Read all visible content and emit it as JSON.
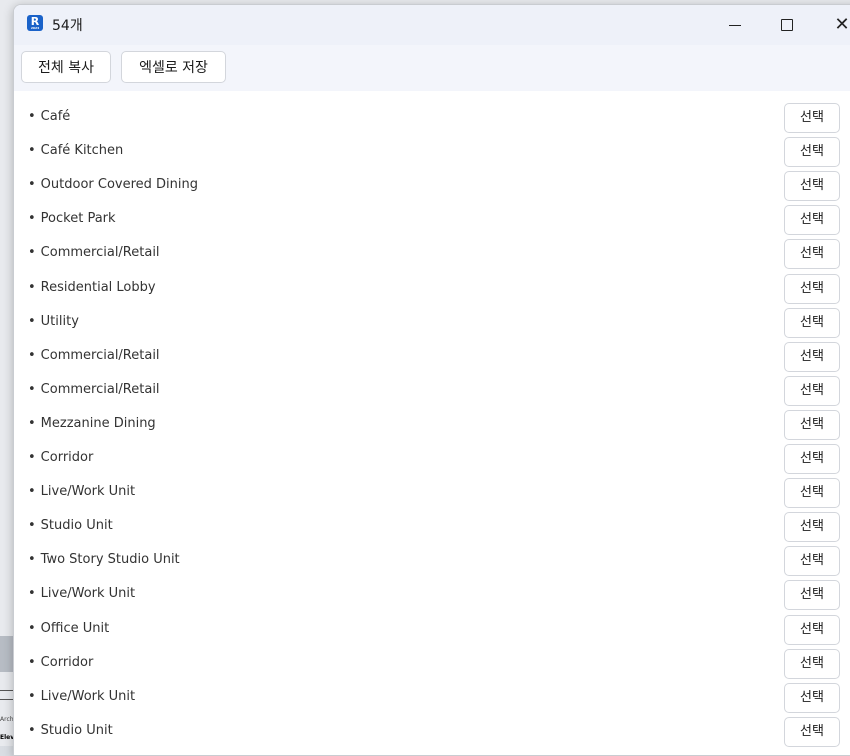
{
  "window": {
    "title": "54개",
    "app_icon_letter": "R",
    "app_icon_sub": "2024",
    "controls": {
      "minimize_icon": "minimize-icon",
      "maximize_icon": "maximize-icon",
      "close_icon": "close-icon",
      "close_glyph": "✕"
    }
  },
  "toolbar": {
    "copy_all_label": "전체 복사",
    "save_excel_label": "엑셀로 저장"
  },
  "list": {
    "bullet": "•",
    "select_label": "선택",
    "items": [
      "Café",
      "Café Kitchen",
      "Outdoor Covered Dining",
      "Pocket Park",
      "Commercial/Retail",
      "Residential Lobby",
      "Utility",
      "Commercial/Retail",
      "Commercial/Retail",
      "Mezzanine Dining",
      "Corridor",
      "Live/Work Unit",
      "Studio Unit",
      "Two Story Studio Unit",
      "Live/Work Unit",
      "Office Unit",
      "Corridor",
      "Live/Work Unit",
      "Studio Unit"
    ]
  },
  "background": {
    "text1": "Arch",
    "text2": "Elev"
  },
  "colors": {
    "titlebar_bg": "#eef1f9",
    "toolbar_bg": "#f3f5fb",
    "app_icon": "#1a62c9"
  }
}
